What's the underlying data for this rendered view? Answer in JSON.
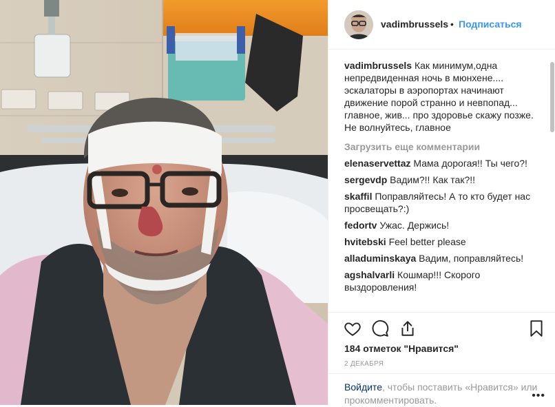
{
  "post": {
    "username": "vadimbrussels",
    "dot": "•",
    "follow_label": "Подписаться",
    "caption": "Как минимум,одна непредвиденная ночь в мюнхене.... эскалаторы в аэропортах начинают движение порой странно и невпопад... главное, жив... про здоровье скажу позже. Не волнуйтесь, главное",
    "load_more": "Загрузить еще комментарии",
    "comments": [
      {
        "user": "elenaservettaz",
        "text": "Мама дорогая!! Ты чего?!"
      },
      {
        "user": "sergevdp",
        "text": "Вадим?!! Как так?!!"
      },
      {
        "user": "skaffil",
        "text": "Поправляйтесь! А то кто будет нас просвещать?:)"
      },
      {
        "user": "fedortv",
        "text": "Ужас. Держись!"
      },
      {
        "user": "hvitebski",
        "text": "Feel better please"
      },
      {
        "user": "alladuminskaya",
        "text": "Вадим, поправляйтесь!"
      },
      {
        "user": "agshalvarli",
        "text": "Кошмар!!! Скорого выздоровления!"
      }
    ],
    "likes": "184 отметок \"Нравится\"",
    "date": "2 ДЕКАБРЯ",
    "login_link": "Войдите",
    "login_text": ", чтобы поставить «Нравится» или прокомментировать.",
    "more_dots": "•••"
  },
  "icons": {
    "like": "heart-icon",
    "comment": "comment-icon",
    "share": "share-icon",
    "save": "bookmark-icon"
  },
  "colors": {
    "accent": "#3897f0",
    "link": "#003569",
    "muted": "#999999"
  }
}
